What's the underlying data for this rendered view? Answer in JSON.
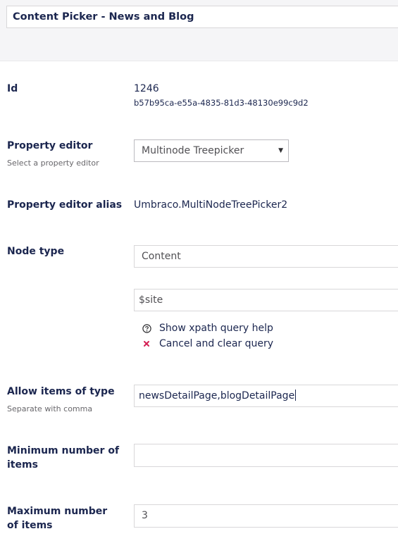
{
  "header": {
    "name_value": "Content Picker - News and Blog"
  },
  "id_field": {
    "label": "Id",
    "id": "1246",
    "guid": "b57b95ca-e55a-4835-81d3-48130e99c9d2"
  },
  "property_editor": {
    "label": "Property editor",
    "description": "Select a property editor",
    "selected": "Multinode Treepicker",
    "caret": "▼"
  },
  "alias": {
    "label": "Property editor alias",
    "value": "Umbraco.MultiNodeTreePicker2"
  },
  "node_type": {
    "label": "Node type",
    "type_value": "Content",
    "query_value": "$site",
    "help_label": "Show xpath query help",
    "clear_label": "Cancel and clear query",
    "clear_icon_color": "#d42054"
  },
  "allow_items": {
    "label": "Allow items of type",
    "description": "Separate with comma",
    "value": "newsDetailPage,blogDetailPage"
  },
  "min_items": {
    "label": "Minimum number of items",
    "value": ""
  },
  "max_items": {
    "label": "Maximum number of items",
    "value": "3"
  }
}
